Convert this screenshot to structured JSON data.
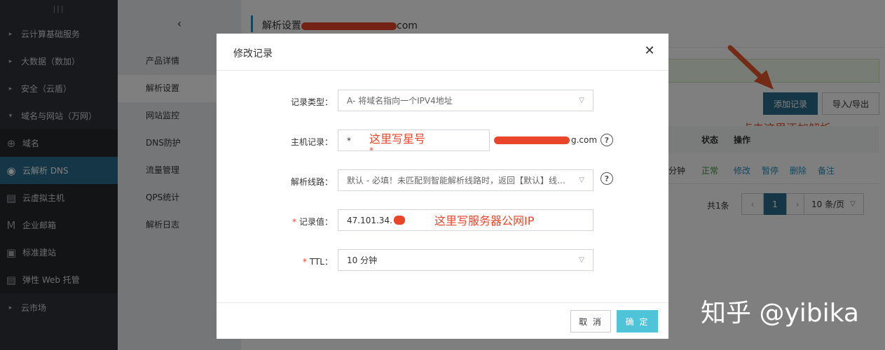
{
  "leftnav": {
    "grip": "|||",
    "items": [
      {
        "label": "云计算基础服务",
        "icon": "caret-right-icon",
        "glyph": "▸"
      },
      {
        "label": "大数据（数加）",
        "icon": "caret-right-icon",
        "glyph": "▸"
      },
      {
        "label": "安全（云盾）",
        "icon": "caret-right-icon",
        "glyph": "▸"
      },
      {
        "label": "域名与网站（万网）",
        "icon": "caret-down-icon",
        "glyph": "▾"
      },
      {
        "label": "域名",
        "icon": "globe-icon",
        "glyph": "⊕"
      },
      {
        "label": "云解析 DNS",
        "icon": "dns-icon",
        "glyph": "◉"
      },
      {
        "label": "云虚拟主机",
        "icon": "server-icon",
        "glyph": "▤"
      },
      {
        "label": "企业邮箱",
        "icon": "mail-icon",
        "glyph": "M"
      },
      {
        "label": "标准建站",
        "icon": "site-icon",
        "glyph": "▣"
      },
      {
        "label": "弹性 Web 托管",
        "icon": "hosting-icon",
        "glyph": "▤"
      },
      {
        "label": "云市场",
        "icon": "caret-right-icon",
        "glyph": "▸"
      }
    ]
  },
  "subnav": {
    "back_glyph": "‹",
    "items": [
      "产品详情",
      "解析设置",
      "网站监控",
      "DNS防护",
      "流量管理",
      "QPS统计",
      "解析日志"
    ]
  },
  "main": {
    "title_prefix": "解析设置",
    "title_suffix": "com",
    "add_button": "添加记录",
    "import_button": "导入/导出",
    "annotation_add": "点击这里添加解析",
    "table": {
      "headers": {
        "status": "状态",
        "actions": "操作"
      },
      "row": {
        "ttl_fragment": "分钟",
        "status": "正常",
        "actions": [
          "修改",
          "暂停",
          "删除",
          "备注"
        ]
      }
    },
    "pager": {
      "total": "共1条",
      "prev": "‹",
      "page": "1",
      "next": "›",
      "page_size": "10 条/页"
    }
  },
  "modal": {
    "title": "修改记录",
    "close_glyph": "✕",
    "fields": {
      "record_type": {
        "label": "记录类型：",
        "value": "A- 将域名指向一个IPV4地址"
      },
      "host": {
        "label": "主机记录：",
        "value": "*",
        "suffix": "g.com",
        "annotation": "这里写星号",
        "annotation_star": "*"
      },
      "line": {
        "label": "解析线路：",
        "value": "默认 - 必填！未匹配到智能解析线路时，返回【默认】线路..."
      },
      "record_value": {
        "required": "*",
        "label": "记录值：",
        "value": "47.101.34.",
        "annotation": "这里写服务器公网IP"
      },
      "ttl": {
        "required": "*",
        "label": "TTL：",
        "value": "10 分钟"
      }
    },
    "help_glyph": "?",
    "cancel": "取 消",
    "ok": "确 定"
  },
  "watermark": "知乎 @yibika",
  "colors": {
    "accent": "#2a6c8c",
    "primary_button": "#4fc3d7",
    "annotation": "#e8452a",
    "nav_bg": "#2e3238"
  }
}
